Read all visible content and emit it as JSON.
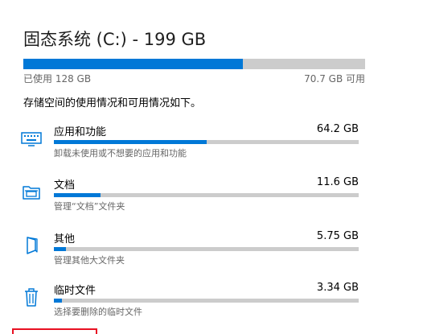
{
  "drive": {
    "title": "固态系统 (C:) - 199 GB",
    "used_label": "已使用 128 GB",
    "free_label": "70.7 GB 可用",
    "used_fraction": 0.643
  },
  "description": "存储空间的使用情况和可用情况如下。",
  "categories": [
    {
      "name": "应用和功能",
      "size": "64.2 GB",
      "desc": "卸载未使用或不想要的应用和功能",
      "fraction": 0.5,
      "icon": "keyboard-icon"
    },
    {
      "name": "文档",
      "size": "11.6 GB",
      "desc": "管理“文档”文件夹",
      "fraction": 0.153,
      "icon": "folder-icon"
    },
    {
      "name": "其他",
      "size": "5.75 GB",
      "desc": "管理其他大文件夹",
      "fraction": 0.04,
      "icon": "document-icon"
    },
    {
      "name": "临时文件",
      "size": "3.34 GB",
      "desc": "选择要删除的临时文件",
      "fraction": 0.027,
      "icon": "trash-icon"
    }
  ],
  "colors": {
    "accent": "#0078d7",
    "track": "#cccccc",
    "highlight": "#e81123"
  }
}
